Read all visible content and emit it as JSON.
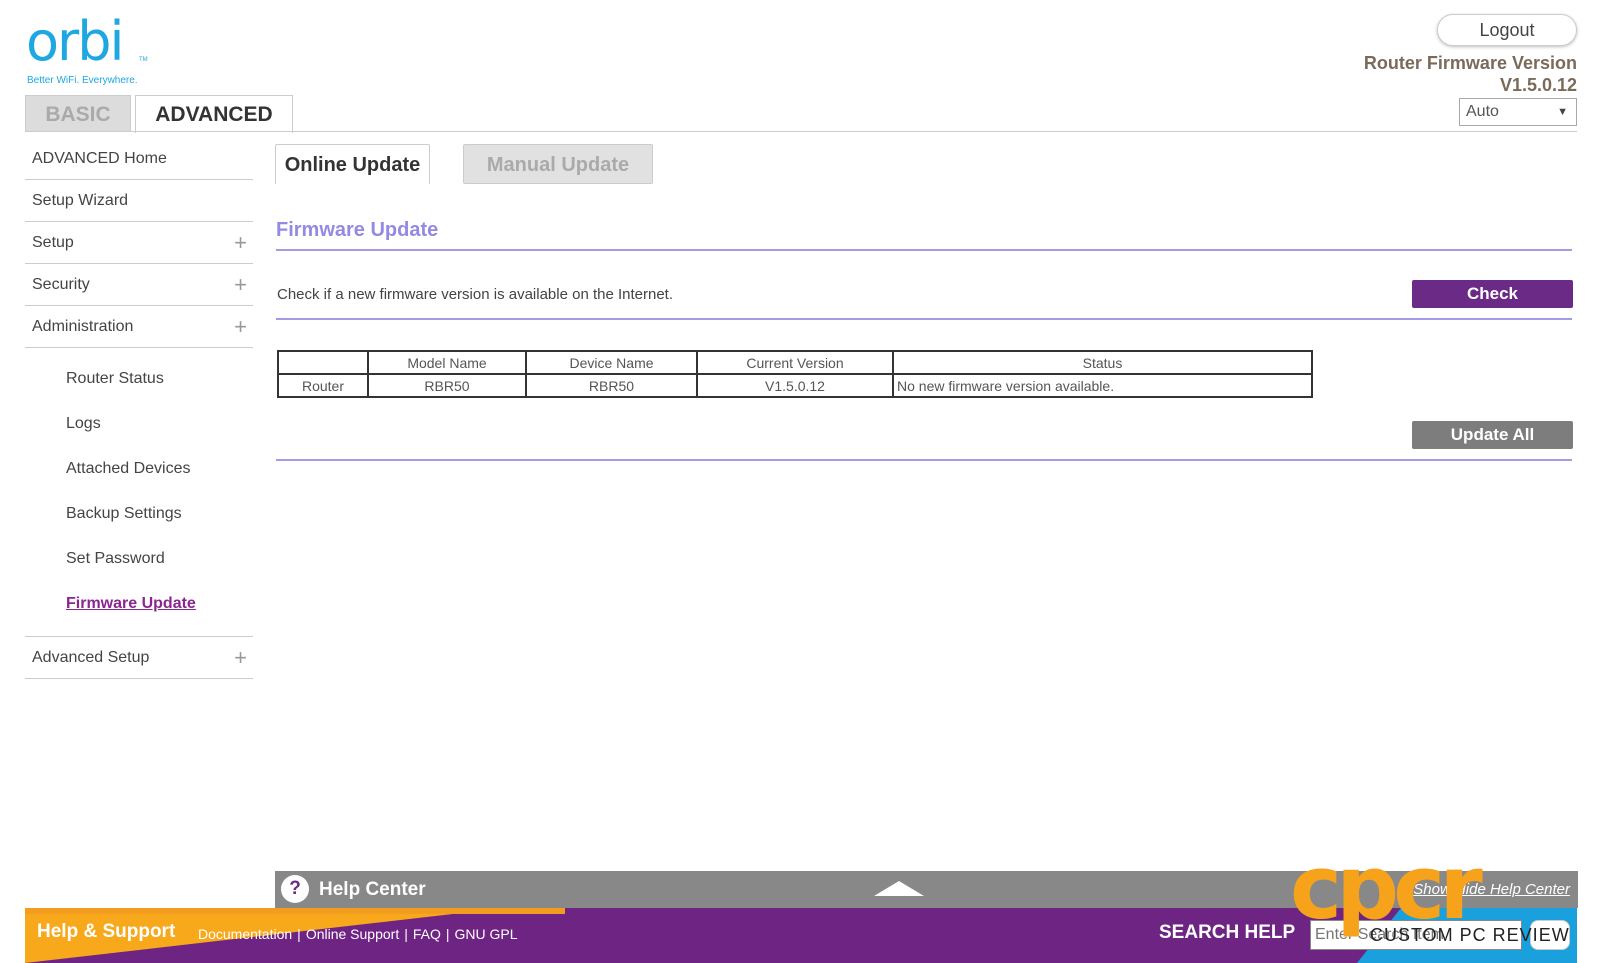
{
  "logo": {
    "word": "orbi",
    "tm": "TM",
    "tagline": "Better WiFi. Everywhere."
  },
  "header": {
    "logout": "Logout",
    "firmware_label": "Router Firmware Version",
    "firmware_version": "V1.5.0.12",
    "language": "Auto"
  },
  "main_tabs": {
    "basic": "BASIC",
    "advanced": "ADVANCED"
  },
  "sidebar": {
    "top_items": [
      {
        "label": "ADVANCED Home"
      },
      {
        "label": "Setup Wizard"
      },
      {
        "label": "Setup"
      },
      {
        "label": "Security"
      },
      {
        "label": "Administration"
      }
    ],
    "admin_items": [
      {
        "label": "Router Status"
      },
      {
        "label": "Logs"
      },
      {
        "label": "Attached Devices"
      },
      {
        "label": "Backup Settings"
      },
      {
        "label": "Set Password"
      },
      {
        "label": "Firmware Update"
      }
    ],
    "advanced_setup": "Advanced Setup"
  },
  "content_tabs": {
    "online": "Online Update",
    "manual": "Manual Update"
  },
  "firmware": {
    "title": "Firmware Update",
    "check_text": "Check if a new firmware version is available on the Internet.",
    "check_button": "Check",
    "update_all_button": "Update All",
    "columns": [
      "",
      "Model Name",
      "Device Name",
      "Current Version",
      "Status"
    ],
    "rows": [
      [
        "Router",
        "RBR50",
        "RBR50",
        "V1.5.0.12",
        "No new firmware version available."
      ]
    ]
  },
  "help_center": {
    "icon": "?",
    "title": "Help Center",
    "toggle": "Show/Hide Help Center"
  },
  "support": {
    "title": "Help & Support",
    "links": [
      "Documentation",
      "Online Support",
      "FAQ",
      "GNU GPL"
    ],
    "search_label": "SEARCH HELP",
    "search_placeholder": "Enter Search Item"
  },
  "watermark": {
    "big": "cpcr",
    "small": "CUSTOM PC REVIEW"
  },
  "colors": {
    "brand_blue": "#1ea7e1",
    "accent_purple": "#6c2a87",
    "title_lavender": "#9489e3",
    "watermark_orange": "#f7a21b"
  }
}
